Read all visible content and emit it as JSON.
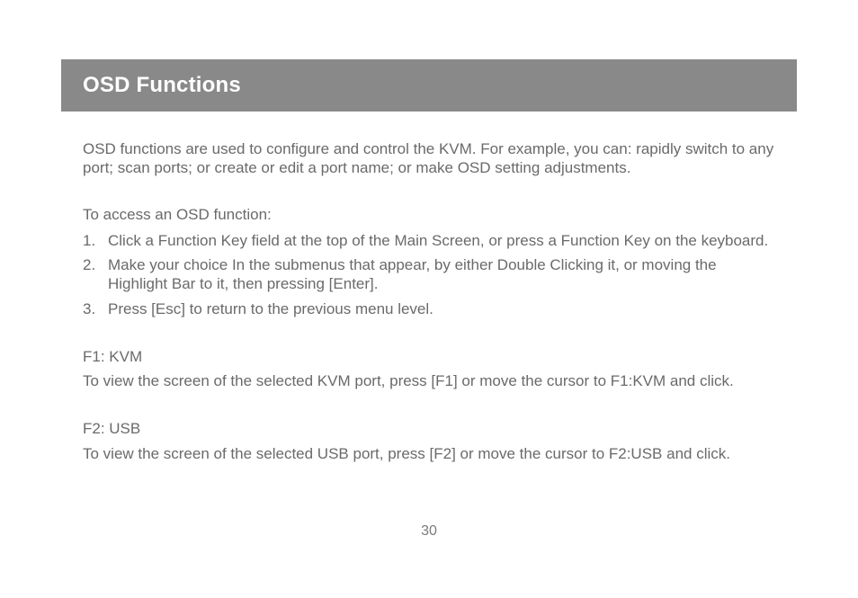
{
  "header": {
    "title": "OSD Functions"
  },
  "intro": "OSD functions are used to configure and control the KVM. For example, you can: rapidly switch to any port; scan ports; or create or edit a port name; or make OSD setting adjustments.",
  "access_heading": "To access an OSD function:",
  "steps": [
    "Click a Function Key field at the top of the Main Screen, or press a Function Key on the keyboard.",
    "Make your choice In the submenus that appear, by either Double Clicking it, or moving the Highlight Bar to it, then pressing [Enter].",
    "Press [Esc] to return to the previous menu level."
  ],
  "f1": {
    "label": "F1: KVM",
    "desc": "To view the screen of the selected KVM port, press [F1] or move the cursor to F1:KVM and click."
  },
  "f2": {
    "label": "F2: USB",
    "desc": "To view the screen of the selected USB port, press [F2] or move the cursor to F2:USB and click."
  },
  "page_number": "30"
}
